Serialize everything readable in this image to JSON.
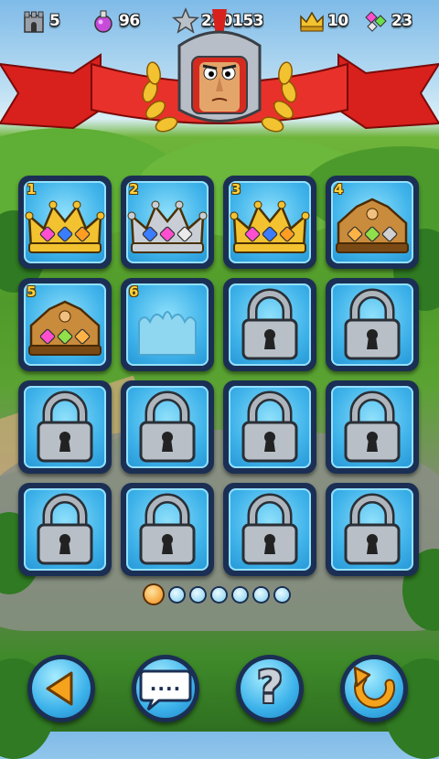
{
  "hud": {
    "castles": {
      "icon": "castle-icon",
      "value": "5"
    },
    "potions": {
      "icon": "potion-icon",
      "value": "96"
    },
    "score": {
      "icon": "star-icon",
      "value": "220153"
    },
    "crowns": {
      "icon": "crown-icon",
      "value": "10"
    },
    "gems": {
      "icon": "gems-icon",
      "value": "23"
    }
  },
  "levels": [
    {
      "number": "1",
      "state": "unlocked",
      "crown": "gold",
      "gems": [
        "#ff4fd0",
        "#3b7dff",
        "#ff9d22"
      ]
    },
    {
      "number": "2",
      "state": "unlocked",
      "crown": "silver",
      "gems": [
        "#3b7dff",
        "#ff4fd0",
        "#eaeaea"
      ]
    },
    {
      "number": "3",
      "state": "unlocked",
      "crown": "gold",
      "gems": [
        "#ff4fd0",
        "#3b7dff",
        "#ff9d22"
      ]
    },
    {
      "number": "4",
      "state": "unlocked",
      "crown": "bronze",
      "gems": [
        "#ffb347",
        "#8fe04a",
        "#d0d0d0"
      ]
    },
    {
      "number": "5",
      "state": "unlocked",
      "crown": "bronze",
      "gems": [
        "#ff4fd0",
        "#8fe04a",
        "#ffb347"
      ]
    },
    {
      "number": "6",
      "state": "unlocked-empty",
      "crown": "outline",
      "gems": []
    },
    {
      "number": "",
      "state": "locked"
    },
    {
      "number": "",
      "state": "locked"
    },
    {
      "number": "",
      "state": "locked"
    },
    {
      "number": "",
      "state": "locked"
    },
    {
      "number": "",
      "state": "locked"
    },
    {
      "number": "",
      "state": "locked"
    },
    {
      "number": "",
      "state": "locked"
    },
    {
      "number": "",
      "state": "locked"
    },
    {
      "number": "",
      "state": "locked"
    },
    {
      "number": "",
      "state": "locked"
    }
  ],
  "pager": {
    "current": 1,
    "total": 7
  },
  "buttons": [
    {
      "name": "back-button",
      "icon": "back-arrow-icon"
    },
    {
      "name": "chat-button",
      "icon": "speech-bubble-icon",
      "label": "...."
    },
    {
      "name": "help-button",
      "icon": "question-mark-icon",
      "label": "?"
    },
    {
      "name": "restart-button",
      "icon": "restart-arrow-icon"
    }
  ],
  "colors": {
    "gold": "#f2c230",
    "silver": "#c9ced6",
    "bronze": "#c98b3c",
    "tile": "#3fb3ea",
    "banner": "#d8201c"
  }
}
